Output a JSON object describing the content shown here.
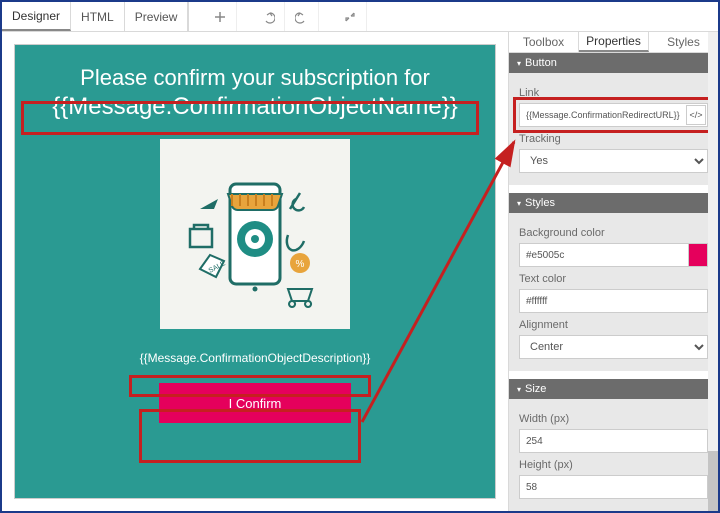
{
  "topbar": {
    "tabs": {
      "designer": "Designer",
      "html": "HTML",
      "preview": "Preview"
    }
  },
  "canvas": {
    "headline": "Please confirm your subscription for",
    "object_name": "{{Message.ConfirmationObjectName}}",
    "object_desc": "{{Message.ConfirmationObjectDescription}}",
    "confirm_label": "I Confirm"
  },
  "sidepanel": {
    "tabs": {
      "toolbox": "Toolbox",
      "properties": "Properties",
      "styles": "Styles"
    },
    "button_section": {
      "title": "Button",
      "link_label": "Link",
      "link_value": "{{Message.ConfirmationRedirectURL}}",
      "code_btn": "</>",
      "tracking_label": "Tracking",
      "tracking_value": "Yes"
    },
    "styles_section": {
      "title": "Styles",
      "bg_label": "Background color",
      "bg_value": "#e5005c",
      "txt_label": "Text color",
      "txt_value": "#ffffff",
      "align_label": "Alignment",
      "align_value": "Center"
    },
    "size_section": {
      "title": "Size",
      "width_label": "Width (px)",
      "width_value": "254",
      "height_label": "Height (px)",
      "height_value": "58"
    }
  }
}
